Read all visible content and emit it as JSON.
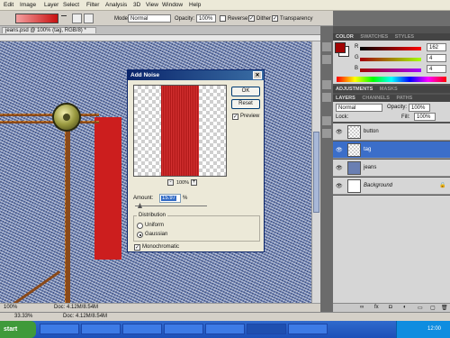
{
  "menu": [
    "Edit",
    "Image",
    "Layer",
    "Select",
    "Filter",
    "Analysis",
    "3D",
    "View",
    "Window",
    "Help"
  ],
  "options": {
    "mode_label": "Mode:",
    "mode_value": "Normal",
    "opacity_label": "Opacity:",
    "opacity_value": "100%",
    "reverse": "Reverse",
    "dither": "Dither",
    "transparency": "Transparency"
  },
  "document": {
    "tab": "jeans.psd @ 100% (tag, RGB/8) *",
    "zoom": "100%",
    "doc_size": "Doc: 4.12M/8.54M"
  },
  "color_panel": {
    "tabs": [
      "COLOR",
      "SWATCHES",
      "STYLES"
    ],
    "r": "162",
    "g": "4",
    "b": "4",
    "r_label": "R",
    "g_label": "G",
    "b_label": "B",
    "fg": "#a20404",
    "bg": "#ffffff"
  },
  "adjust_panel": {
    "tabs": [
      "ADJUSTMENTS",
      "MASKS"
    ]
  },
  "layers_panel": {
    "tabs": [
      "LAYERS",
      "CHANNELS",
      "PATHS"
    ],
    "blend": "Normal",
    "opacity_label": "Opacity:",
    "opacity_value": "100%",
    "lock_label": "Lock:",
    "fill_label": "Fill:",
    "fill_value": "100%",
    "layers": [
      {
        "name": "button",
        "selected": false
      },
      {
        "name": "tag",
        "selected": true
      },
      {
        "name": "jeans",
        "selected": false
      },
      {
        "name": "Background",
        "selected": false
      }
    ]
  },
  "dialog": {
    "title": "Add Noise",
    "ok": "OK",
    "reset": "Reset",
    "preview": "Preview",
    "zoom": "100%",
    "amount_label": "Amount:",
    "amount_value": "15.97",
    "amount_unit": "%",
    "distribution_label": "Distribution",
    "uniform": "Uniform",
    "gaussian": "Gaussian",
    "monochromatic": "Monochromatic",
    "minus": "-",
    "plus": "+"
  },
  "status": {
    "zoom": "33.33%",
    "doc": "Doc: 4.12M/8.54M"
  },
  "taskbar": {
    "start": "start",
    "tasks": [
      "",
      "",
      "",
      "",
      "",
      "",
      ""
    ],
    "clock": "12:00"
  }
}
